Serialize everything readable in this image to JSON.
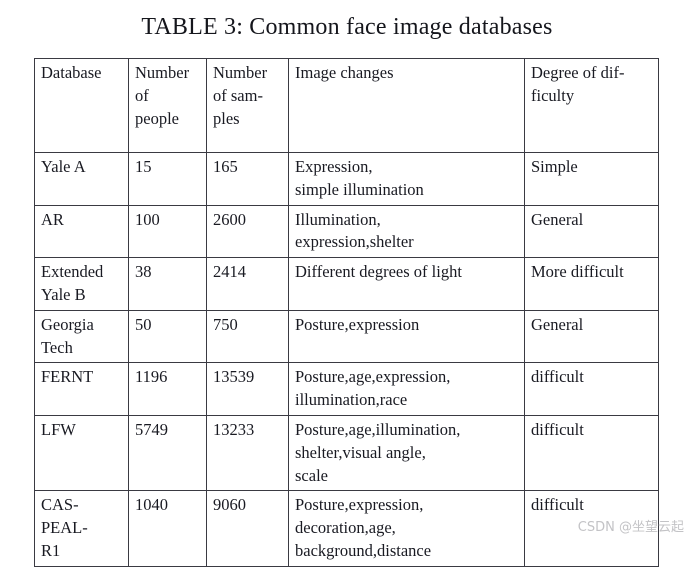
{
  "caption": "TABLE 3: Common face image databases",
  "table": {
    "columns": [
      {
        "key": "database",
        "lines": [
          "Database"
        ]
      },
      {
        "key": "num_people",
        "lines": [
          "Number",
          "of",
          "people"
        ]
      },
      {
        "key": "num_samples",
        "lines": [
          "Number",
          "of sam-",
          "ples"
        ]
      },
      {
        "key": "changes",
        "lines": [
          "Image changes"
        ]
      },
      {
        "key": "difficulty",
        "lines": [
          "Degree of dif-",
          "ficulty"
        ]
      }
    ],
    "rows": [
      {
        "database": [
          "Yale A"
        ],
        "num_people": [
          "15"
        ],
        "num_samples": [
          "165"
        ],
        "changes": [
          "Expression,",
          "simple illumination"
        ],
        "difficulty": [
          "Simple"
        ]
      },
      {
        "database": [
          "AR"
        ],
        "num_people": [
          "100"
        ],
        "num_samples": [
          "2600"
        ],
        "changes": [
          "Illumination,",
          "expression,shelter"
        ],
        "difficulty": [
          "General"
        ]
      },
      {
        "database": [
          "Extended",
          "Yale B"
        ],
        "num_people": [
          "38"
        ],
        "num_samples": [
          "2414"
        ],
        "changes": [
          "Different degrees of light"
        ],
        "difficulty": [
          "More difficult"
        ]
      },
      {
        "database": [
          "Georgia",
          "Tech"
        ],
        "num_people": [
          "50"
        ],
        "num_samples": [
          "750"
        ],
        "changes": [
          "Posture,expression"
        ],
        "difficulty": [
          "General"
        ]
      },
      {
        "database": [
          "FERNT"
        ],
        "num_people": [
          "1196"
        ],
        "num_samples": [
          "13539"
        ],
        "changes": [
          "Posture,age,expression,",
          "illumination,race"
        ],
        "difficulty": [
          "difficult"
        ]
      },
      {
        "database": [
          "LFW"
        ],
        "num_people": [
          "5749"
        ],
        "num_samples": [
          "13233"
        ],
        "changes": [
          "Posture,age,illumination,",
          "shelter,visual angle,",
          "scale"
        ],
        "difficulty": [
          "difficult"
        ]
      },
      {
        "database": [
          "CAS-",
          "PEAL-",
          "R1"
        ],
        "num_people": [
          "1040"
        ],
        "num_samples": [
          "9060"
        ],
        "changes": [
          "Posture,expression,",
          "decoration,age,",
          "background,distance"
        ],
        "difficulty": [
          "difficult"
        ]
      }
    ]
  },
  "watermark": "CSDN @坐望云起",
  "colors": {
    "text": "#16171d",
    "border": "#3a3a42",
    "background": "#ffffff",
    "watermark": "#c3c3c6"
  }
}
